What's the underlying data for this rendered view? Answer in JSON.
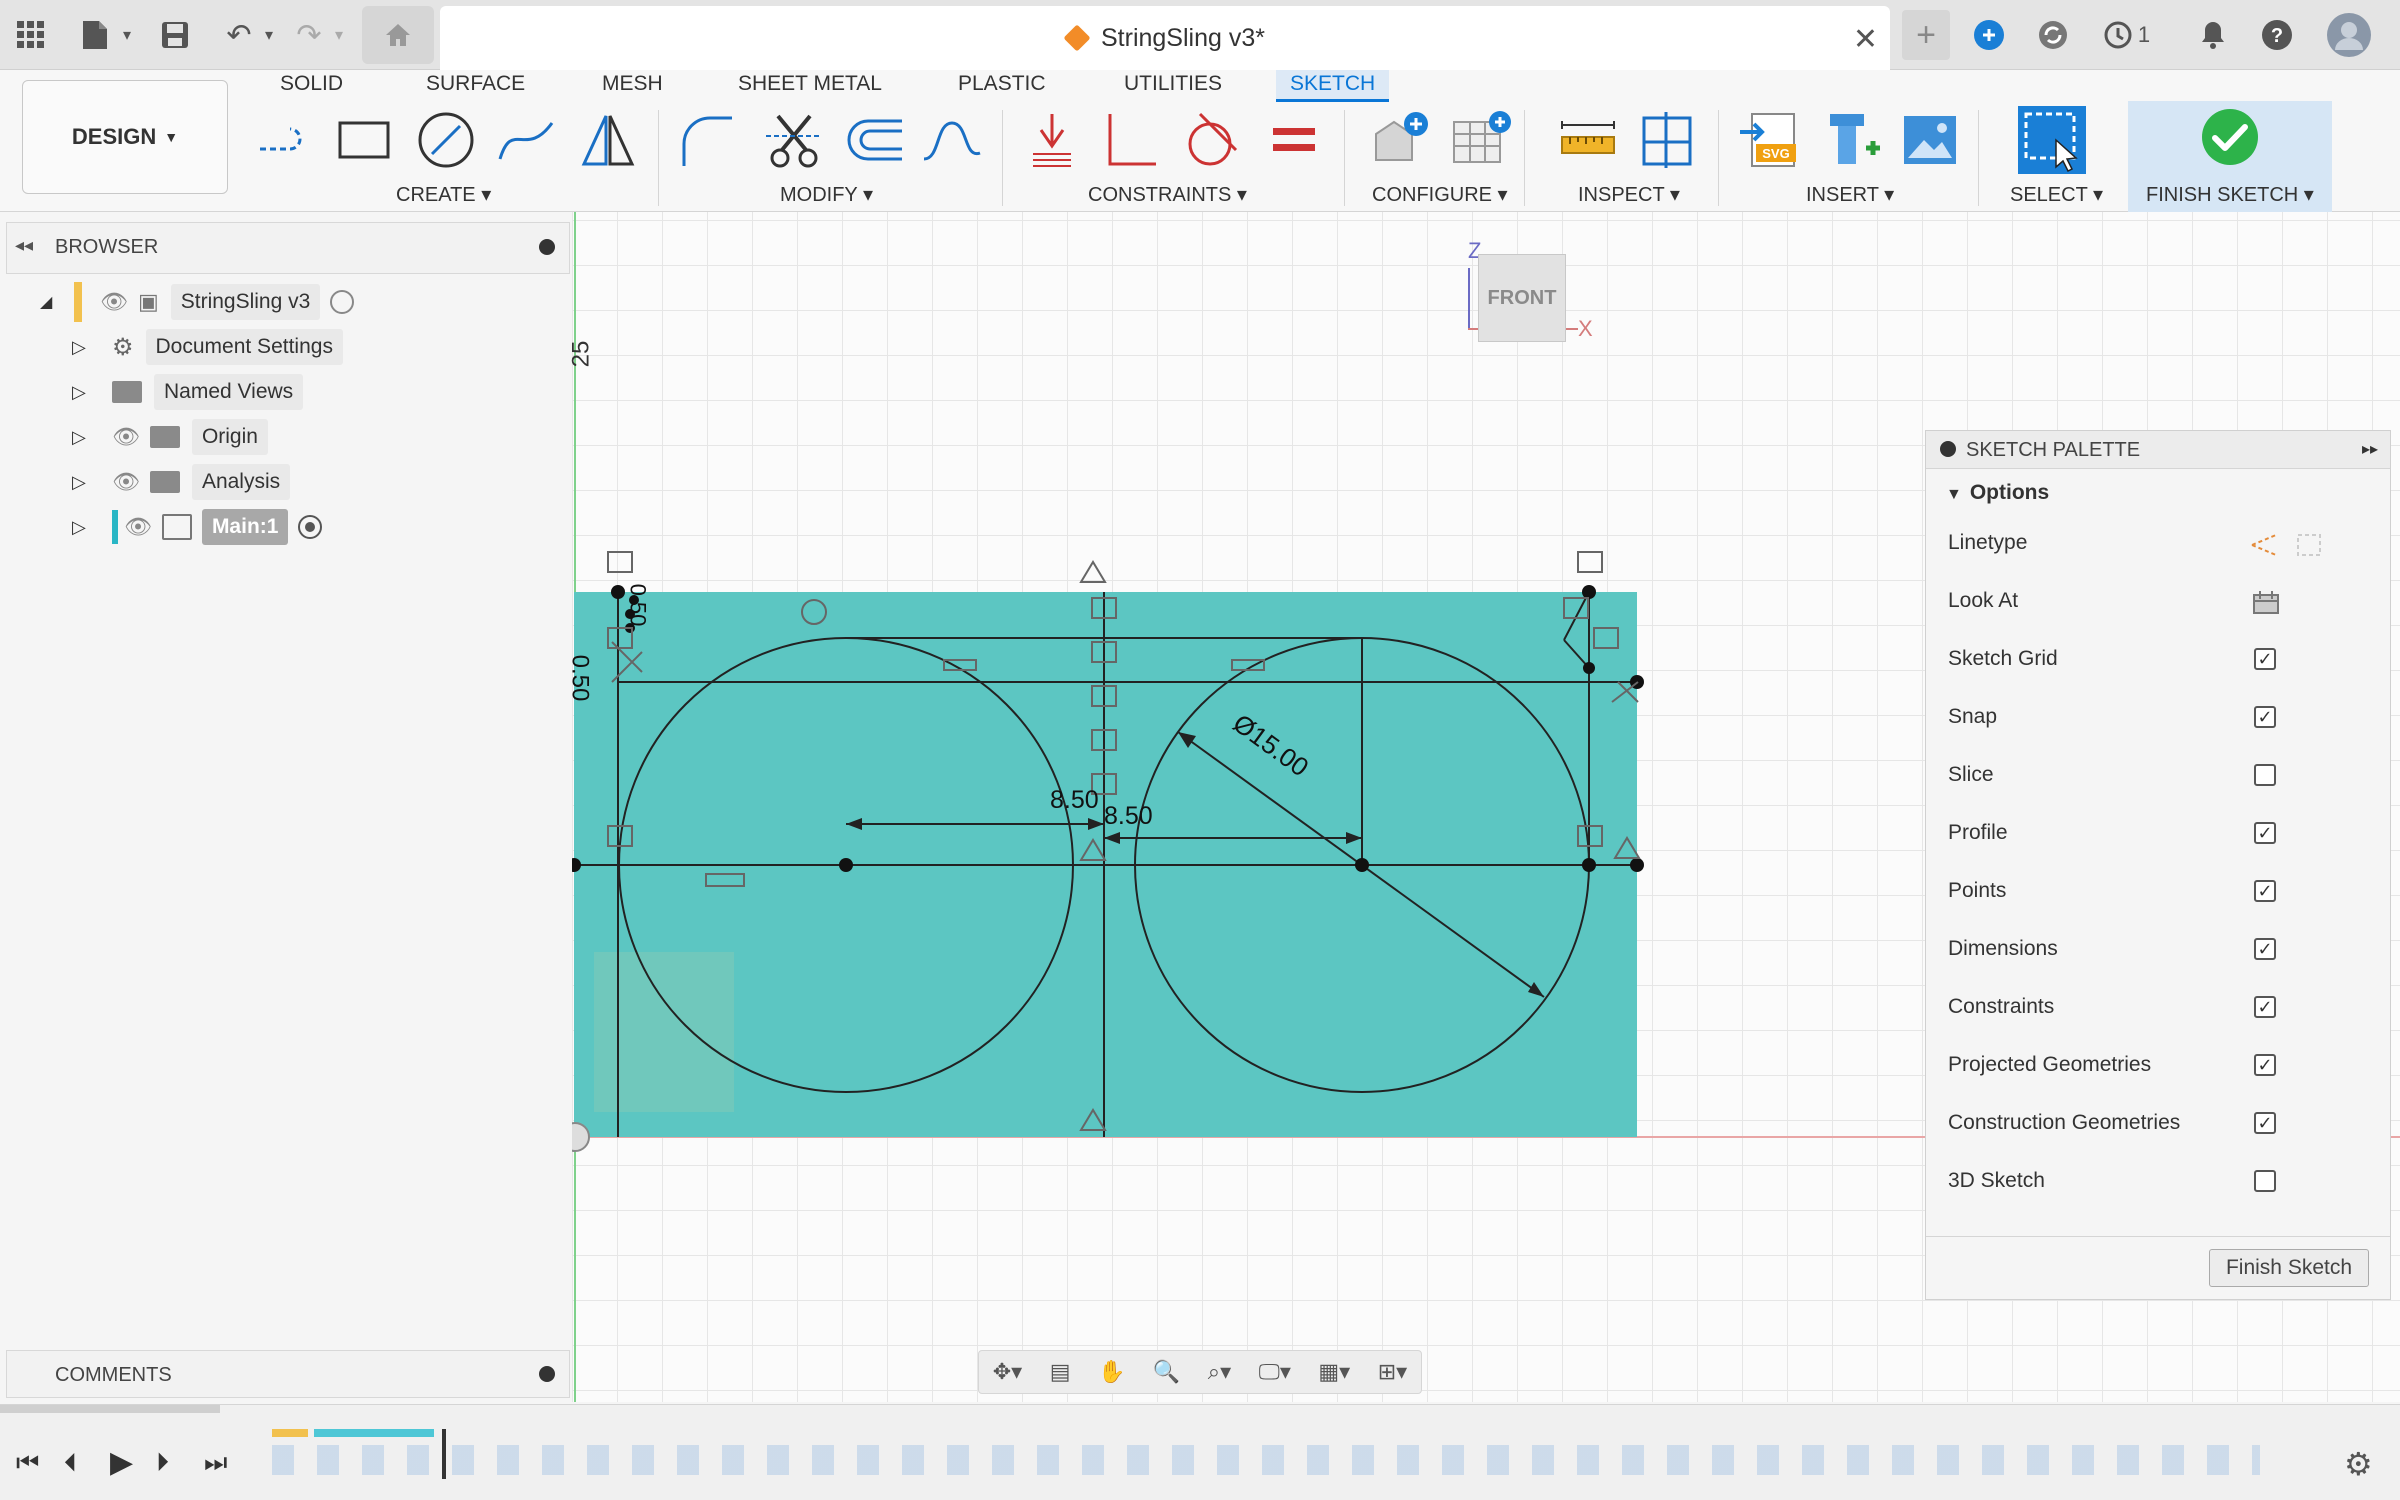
{
  "titlebar": {
    "doc_title": "StringSling v3*",
    "job_count": "1"
  },
  "toolbar": {
    "design_label": "DESIGN",
    "tabs": [
      "SOLID",
      "SURFACE",
      "MESH",
      "SHEET METAL",
      "PLASTIC",
      "UTILITIES",
      "SKETCH"
    ],
    "groups": {
      "create": "CREATE",
      "modify": "MODIFY",
      "constraints": "CONSTRAINTS",
      "configure": "CONFIGURE",
      "inspect": "INSPECT",
      "insert": "INSERT",
      "select": "SELECT",
      "finish": "FINISH SKETCH"
    },
    "accent": "#0a76d6"
  },
  "browser": {
    "title": "BROWSER",
    "items": [
      {
        "label": "StringSling v3"
      },
      {
        "label": "Document Settings"
      },
      {
        "label": "Named Views"
      },
      {
        "label": "Origin"
      },
      {
        "label": "Analysis"
      },
      {
        "label": "Main:1"
      }
    ]
  },
  "canvas": {
    "ruler_label": "25",
    "dims": {
      "d1": "8.50",
      "d2": "8.50",
      "diameter": "Ø15.00",
      "small": "0.50",
      "small2": "0.50"
    },
    "viewcube": {
      "face": "FRONT",
      "z": "Z",
      "x": "X"
    },
    "sketch_color": "#5cc6c2"
  },
  "palette": {
    "title": "SKETCH PALETTE",
    "section": "Options",
    "rows": [
      {
        "label": "Linetype"
      },
      {
        "label": "Look At"
      },
      {
        "label": "Sketch Grid",
        "checked": true
      },
      {
        "label": "Snap",
        "checked": true
      },
      {
        "label": "Slice",
        "checked": false
      },
      {
        "label": "Profile",
        "checked": true
      },
      {
        "label": "Points",
        "checked": true
      },
      {
        "label": "Dimensions",
        "checked": true
      },
      {
        "label": "Constraints",
        "checked": true
      },
      {
        "label": "Projected Geometries",
        "checked": true
      },
      {
        "label": "Construction Geometries",
        "checked": true
      },
      {
        "label": "3D Sketch",
        "checked": false
      }
    ],
    "finish_button": "Finish Sketch"
  },
  "comments": {
    "title": "COMMENTS"
  }
}
